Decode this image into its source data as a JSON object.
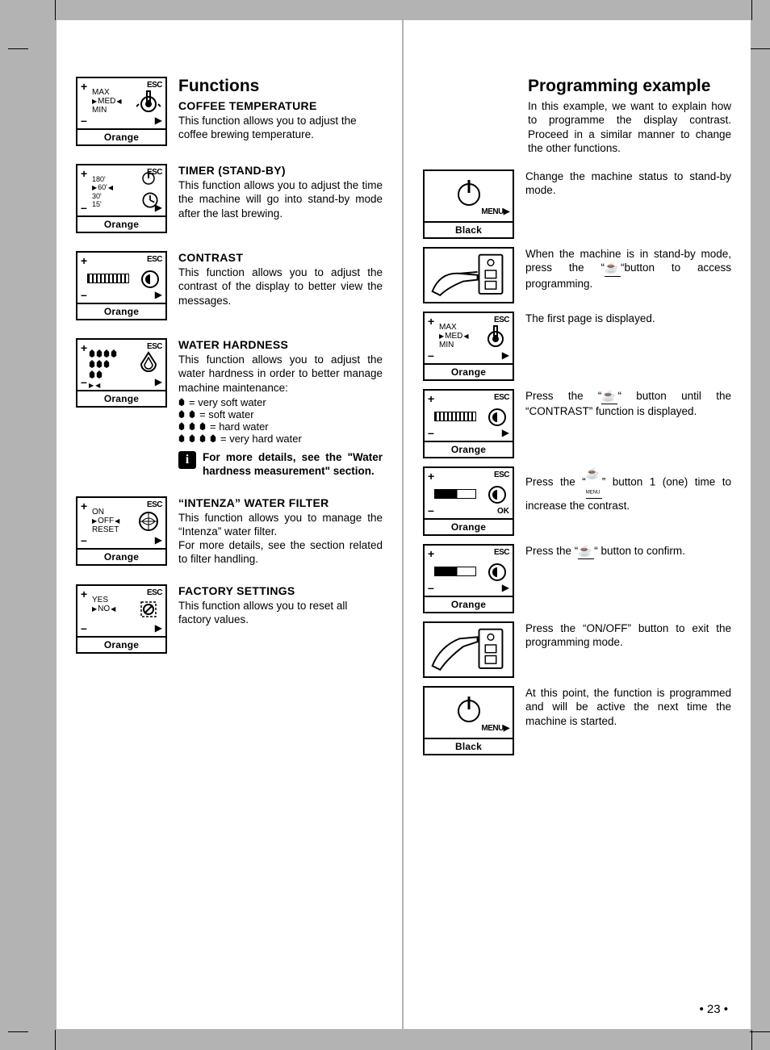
{
  "left": {
    "heading": "Functions",
    "items": [
      {
        "title": "COFFEE TEMPERATURE",
        "text": "This function allows you to adjust the coffee brewing temperature.",
        "screen": {
          "lines": [
            "MAX",
            "MED",
            "MIN"
          ],
          "sel": 1,
          "cap": "Orange",
          "icon": "thermo"
        }
      },
      {
        "title": "TIMER (STAND-BY)",
        "text": "This function allows you to adjust the time the machine will go into stand-by mode after the last brewing.",
        "screen": {
          "lines": [
            "180'",
            "60'",
            "30'",
            "15'"
          ],
          "sel": 1,
          "cap": "Orange",
          "icon": "clock"
        }
      },
      {
        "title": "CONTRAST",
        "text": "This function allows you to adjust the contrast of the display to better view the messages.",
        "screen": {
          "cap": "Orange",
          "bar": true,
          "dial": true
        }
      },
      {
        "title": "WATER HARDNESS",
        "text": "This function allows you to adjust the water hardness in order to better manage machine maintenance:",
        "bullets": [
          {
            "level": 1,
            "label": "= very soft water"
          },
          {
            "level": 2,
            "label": "= soft water"
          },
          {
            "level": 3,
            "label": "= hard water"
          },
          {
            "level": 4,
            "label": "= very hard water"
          }
        ],
        "info": "For more details, see the \"Water hardness measurement\" section.",
        "screen": {
          "cap": "Orange",
          "icon": "drop",
          "hardness": true
        }
      },
      {
        "title": "“INTENZA” WATER FILTER",
        "text": "This function allows you to manage the “Intenza” water filter.\nFor more details, see the section related to filter handling.",
        "screen": {
          "lines": [
            "ON",
            "OFF",
            "RESET"
          ],
          "sel": 1,
          "cap": "Orange",
          "icon": "filter"
        }
      },
      {
        "title": "FACTORY SETTINGS",
        "text": "This function allows you to reset all factory values.",
        "screen": {
          "lines": [
            "YES",
            "NO"
          ],
          "sel": 1,
          "cap": "Orange",
          "icon": "reset"
        }
      }
    ]
  },
  "right": {
    "heading": "Programming example",
    "intro": "In this example, we want to explain how to programme the display contrast. Proceed in a similar manner to change the other functions.",
    "steps": [
      {
        "text": "Change the machine status to stand-by mode.",
        "screen": {
          "power": true,
          "menu": "MENU▶",
          "cap": "Black"
        }
      },
      {
        "text_pre": "When the machine is in stand-by mode, press the “",
        "text_post": "“button to access programming.",
        "hand": true
      },
      {
        "text": "The first page is displayed.",
        "screen": {
          "lines": [
            "MAX",
            "MED",
            "MIN"
          ],
          "sel": 1,
          "cap": "Orange",
          "icon": "thermo"
        }
      },
      {
        "text_pre": "Press the “",
        "text_post": "“ button until the “CONTRAST” function is displayed.",
        "screen": {
          "bar": true,
          "dial": true,
          "cap": "Orange"
        }
      },
      {
        "text_pre": "Press the “",
        "text_post": "” button 1 (one) time to increase the contrast.",
        "screen": {
          "bar": true,
          "dial": true,
          "cap": "Orange",
          "ok": "OK"
        }
      },
      {
        "text_pre": "Press the  “",
        "text_post": "“ button to confirm.",
        "screen": {
          "bar": true,
          "dial": true,
          "cap": "Orange"
        }
      },
      {
        "text": "Press the “ON/OFF” button to exit the programming mode.",
        "hand": true
      },
      {
        "text": "At this point, the function is programmed and will be active the next time the machine is started.",
        "screen": {
          "power": true,
          "menu": "MENU▶",
          "cap": "Black"
        }
      }
    ]
  },
  "page_number": "• 23 •"
}
